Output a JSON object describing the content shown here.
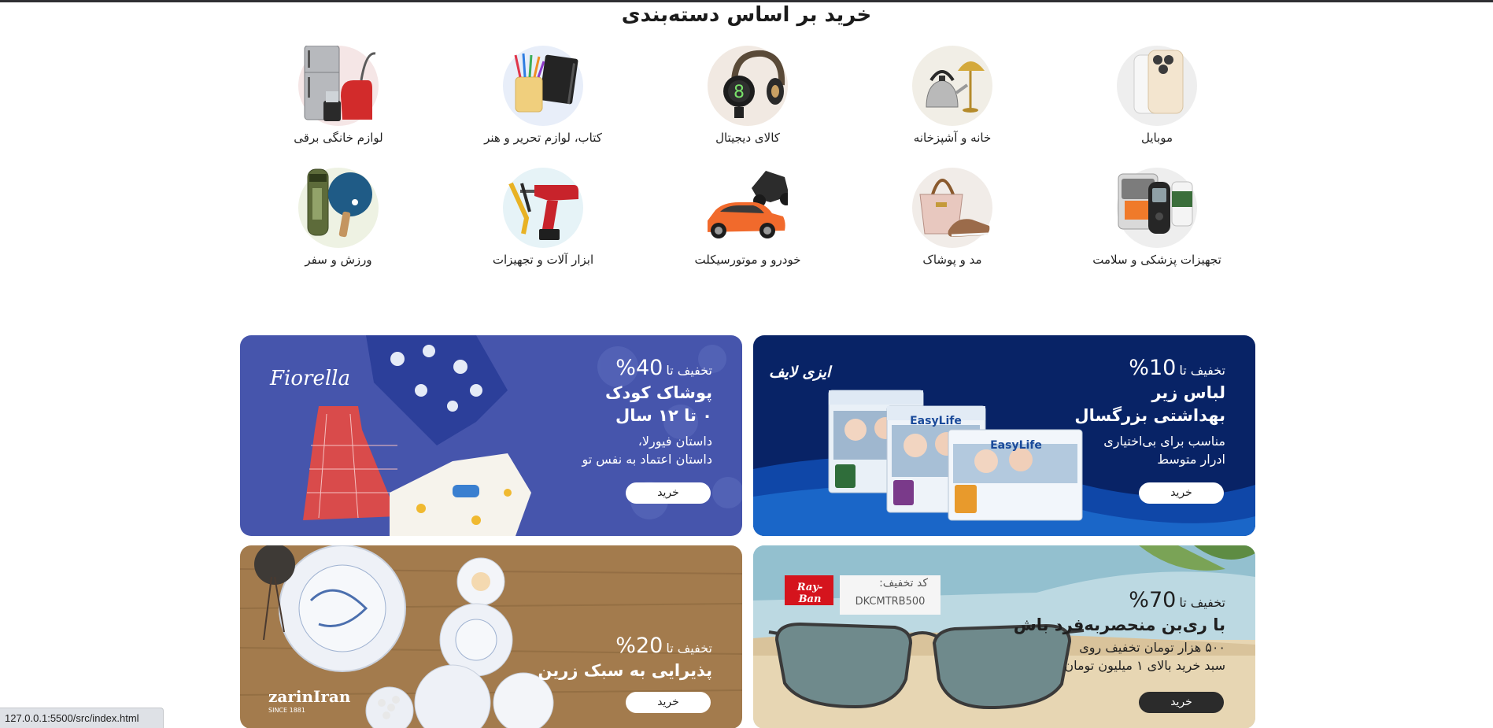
{
  "page": {
    "section_title": "خرید بر اساس دسته‌بندی"
  },
  "categories": [
    {
      "label": "موبایل",
      "icon": "phone-icon"
    },
    {
      "label": "خانه و آشپزخانه",
      "icon": "kettle-icon"
    },
    {
      "label": "کالای دیجیتال",
      "icon": "headphones-icon"
    },
    {
      "label": "کتاب، لوازم تحریر و هنر",
      "icon": "notebook-icon"
    },
    {
      "label": "لوازم خانگی برقی",
      "icon": "fridge-icon"
    },
    {
      "label": "تجهیزات پزشکی و سلامت",
      "icon": "medical-icon"
    },
    {
      "label": "مد و پوشاک",
      "icon": "bag-icon"
    },
    {
      "label": "خودرو و موتورسیکلت",
      "icon": "car-icon"
    },
    {
      "label": "ابزار آلات و تجهیزات",
      "icon": "drill-icon"
    },
    {
      "label": "ورزش و سفر",
      "icon": "sports-icon"
    }
  ],
  "banners": {
    "easylife": {
      "brand": "ایزی لایف",
      "discount_prefix": "تخفیف تا",
      "discount_value": "10%",
      "headline_1": "لباس زیر",
      "headline_2": "بهداشتی بزرگسال",
      "sub_1": "مناسب برای بی‌اختیاری",
      "sub_2": "ادرار متوسط",
      "buy": "خرید",
      "package_brand": "EasyLife",
      "bg_color": "#0b2b74"
    },
    "fiorella": {
      "brand": "Fiorella",
      "discount_prefix": "تخفیف تا",
      "discount_value": "40%",
      "headline_1": "پوشاک کودک",
      "headline_2": "۰ تا ۱۲ سال",
      "sub_1": "داستان فیورلا،",
      "sub_2": "داستان اعتماد به نفس تو",
      "buy": "خرید",
      "bg_color": "#4753ac"
    },
    "rayban": {
      "brand": "Ray-Ban",
      "coupon_label": "کد تخفیف:",
      "coupon_code": "DKCMTRB500",
      "discount_prefix": "تخفیف تا",
      "discount_value": "70%",
      "headline_1": "با ری‌بن منحصربه‌فرد باش",
      "sub_1": "۵۰۰ هزار تومان تخفیف روی",
      "sub_2": "سبد خرید بالای ۱ میلیون تومان",
      "buy": "خرید",
      "bg_color": "#d9cdb2"
    },
    "zarin": {
      "brand": "zarinIran",
      "brand_since": "SINCE 1881",
      "discount_prefix": "تخفیف تا",
      "discount_value": "20%",
      "headline_1": "پذیرایی به سبک زرین",
      "buy": "خرید",
      "bg_color": "#a27a4c"
    }
  },
  "status_bar": {
    "url": "127.0.0.1:5500/src/index.html"
  }
}
